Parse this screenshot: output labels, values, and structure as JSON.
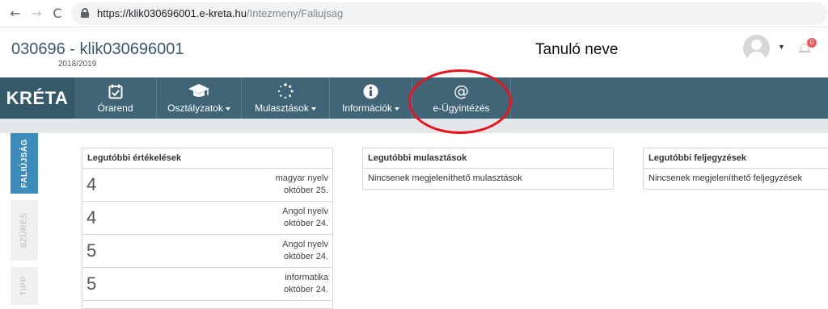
{
  "browser": {
    "url_host": "https://klik030696001.e-kreta.hu",
    "url_path": "/Intezmeny/Faliujsag",
    "back_glyph": "←",
    "forward_glyph": "→",
    "reload_glyph": "C"
  },
  "header": {
    "school_code": "030696 - klik030696001",
    "school_year": "2018/2019",
    "student_name": "Tanuló neve",
    "notification_count": "0"
  },
  "nav": {
    "logo": "KRÉTA",
    "items": [
      {
        "label": "Órarend",
        "icon": "calendar-check-icon",
        "dropdown": false
      },
      {
        "label": "Osztályzatok",
        "icon": "graduation-cap-icon",
        "dropdown": true
      },
      {
        "label": "Mulasztások",
        "icon": "spinner-icon",
        "dropdown": true
      },
      {
        "label": "Információk",
        "icon": "info-circle-icon",
        "dropdown": true
      },
      {
        "label": "e-Ügyintézés",
        "icon": "at-sign-icon",
        "dropdown": false
      }
    ]
  },
  "side_tabs": [
    "FALIÚJSÁG",
    "SZŰRÉS",
    "TIPP"
  ],
  "panels": {
    "grades": {
      "title": "Legutóbbi értékelések",
      "rows": [
        {
          "value": "4",
          "subject": "magyar nyelv",
          "date": "október 25."
        },
        {
          "value": "4",
          "subject": "Angol nyelv",
          "date": "október 24."
        },
        {
          "value": "5",
          "subject": "Angol nyelv",
          "date": "október 24."
        },
        {
          "value": "5",
          "subject": "informatika",
          "date": "október 24."
        }
      ]
    },
    "absences": {
      "title": "Legutóbbi mulasztások",
      "empty_text": "Nincsenek megjeleníthető mulasztások"
    },
    "notes": {
      "title": "Legutóbbi feljegyzések",
      "empty_text": "Nincsenek megjeleníthető feljegyzések"
    }
  },
  "colors": {
    "nav_bg": "#3f6577",
    "logo_bg": "#36596a",
    "active_tab": "#3c8dbc",
    "annotation": "#e8151e",
    "badge": "#f05a5a"
  }
}
